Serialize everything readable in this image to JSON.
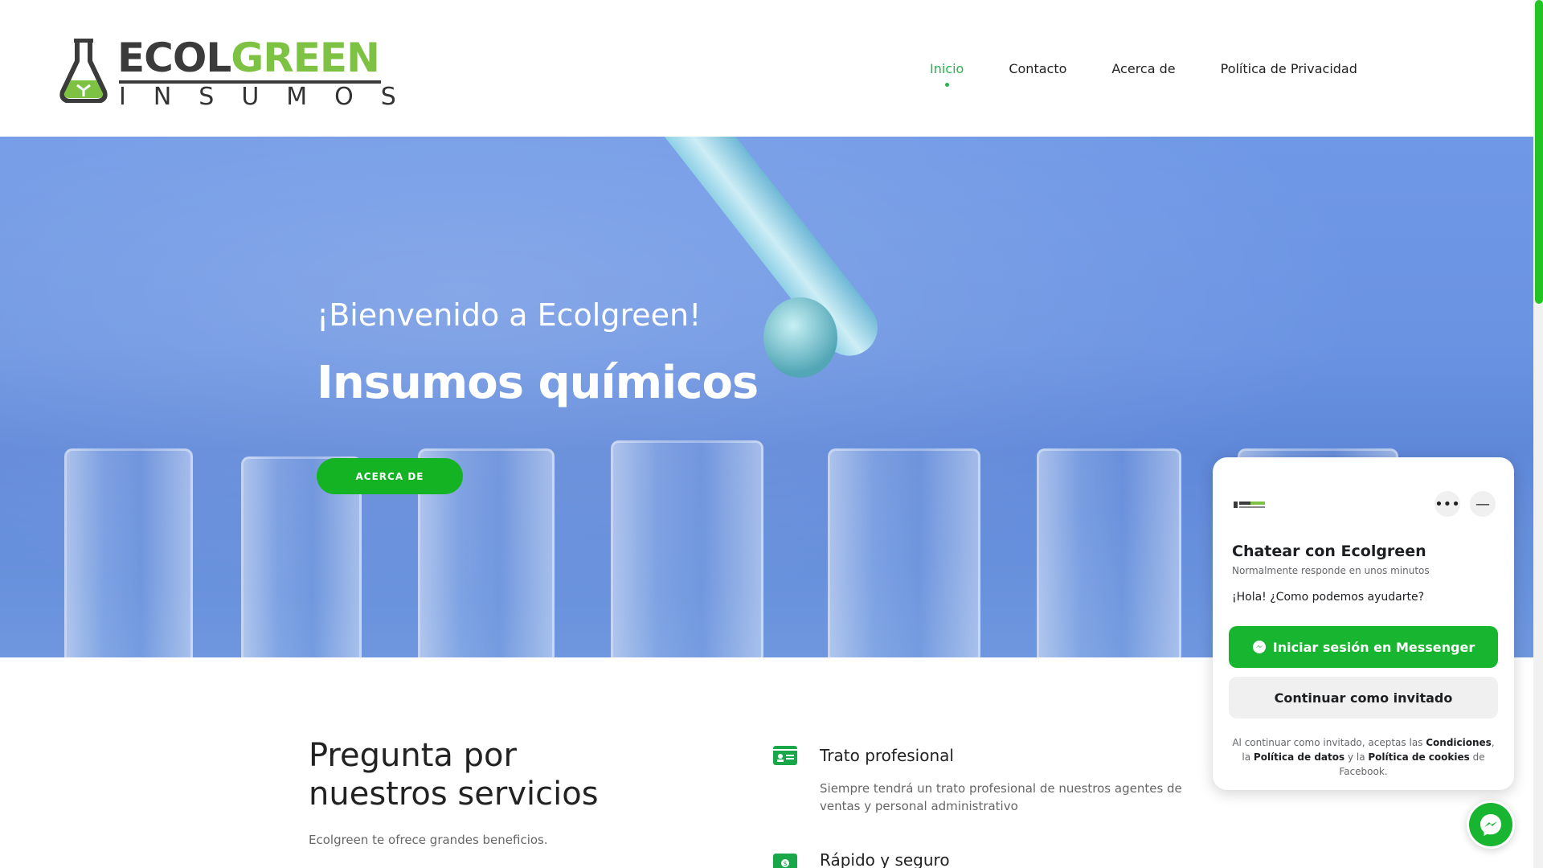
{
  "logo": {
    "brand_a": "ECOL",
    "brand_b": "GREEN",
    "sub": "INSUMOS"
  },
  "nav": {
    "items": [
      "Inicio",
      "Contacto",
      "Acerca de",
      "Política de Privacidad"
    ],
    "active": "Inicio"
  },
  "hero": {
    "subtitle": "¡Bienvenido a Ecolgreen!",
    "title": "Insumos químicos",
    "button": "ACERCA DE"
  },
  "services": {
    "heading": "Pregunta por nuestros servicios",
    "lead": "Ecolgreen te ofrece grandes beneficios.",
    "features": [
      {
        "title": "Trato profesional",
        "text": "Siempre tendrá un trato profesional de nuestros agentes de ventas y personal administrativo",
        "icon": "id-card-icon"
      },
      {
        "title": "Rápido y seguro",
        "icon": "money-icon"
      }
    ]
  },
  "chat": {
    "title": "Chatear con Ecolgreen",
    "subtitle": "Normalmente responde en unos minutos",
    "greeting": "¡Hola! ¿Como podemos ayudarte?",
    "primary_button": "Iniciar sesión en Messenger",
    "secondary_button": "Continuar como invitado",
    "legal_1": "Al continuar como invitado, aceptas las ",
    "legal_terms": "Condiciones",
    "legal_2": ", la ",
    "legal_data": "Política de datos",
    "legal_3": " y la ",
    "legal_cookies": "Política de cookies",
    "legal_4": " de Facebook."
  },
  "colors": {
    "accent": "#2bb24c",
    "button_green": "#13b324",
    "logo_green": "#7dc242",
    "hero_blue": "#6a93e2"
  }
}
